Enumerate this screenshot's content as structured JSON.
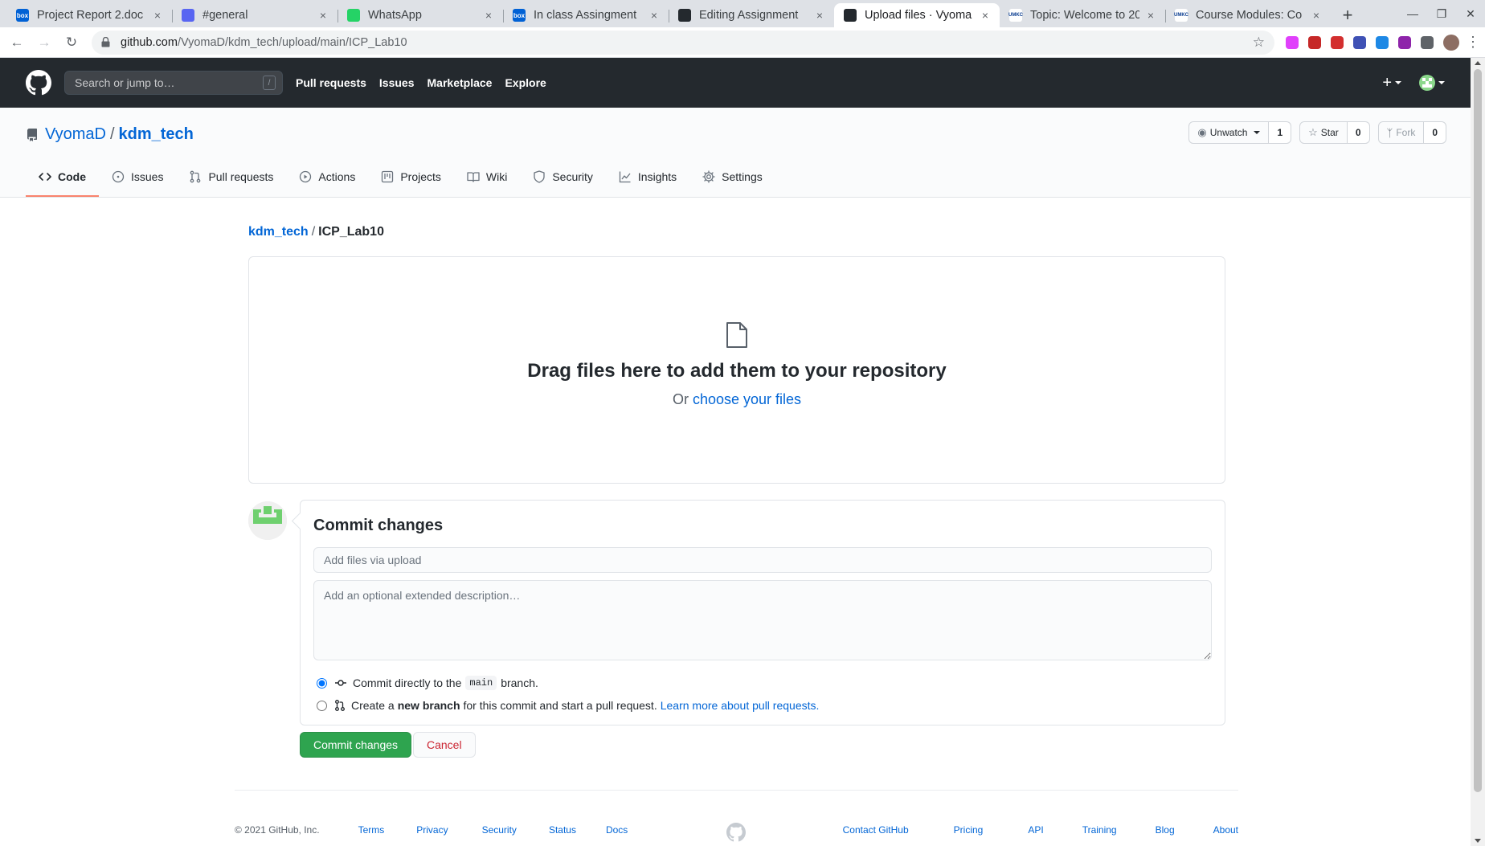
{
  "browser": {
    "tabs": [
      {
        "label": "Project Report 2.doc",
        "fav_color": "#0061d5",
        "fav_text": "box",
        "active": false
      },
      {
        "label": "#general",
        "fav_color": "#5865f2",
        "fav_text": "",
        "active": false
      },
      {
        "label": "WhatsApp",
        "fav_color": "#25d366",
        "fav_text": "",
        "active": false
      },
      {
        "label": "In class Assingment",
        "fav_color": "#0061d5",
        "fav_text": "box",
        "active": false
      },
      {
        "label": "Editing Assignment",
        "fav_color": "#24292e",
        "fav_text": "",
        "active": false
      },
      {
        "label": "Upload files · Vyoma",
        "fav_color": "#24292e",
        "fav_text": "",
        "active": true
      },
      {
        "label": "Topic: Welcome to 20",
        "fav_color": "#ffffff",
        "fav_text": "UMKC",
        "active": false
      },
      {
        "label": "Course Modules: Co",
        "fav_color": "#ffffff",
        "fav_text": "UMKC",
        "active": false
      }
    ],
    "new_tab": "+",
    "close_glyph": "×",
    "url_host": "github.com",
    "url_path": "/VyomaD/kdm_tech/upload/main/ICP_Lab10",
    "extension_colors": [
      "#e040fb",
      "#c62828",
      "#d32f2f",
      "#3f51b5",
      "#1e88e5",
      "#8e24aa",
      "#5f6368"
    ]
  },
  "gh_header": {
    "search_placeholder": "Search or jump to…",
    "search_key": "/",
    "nav": [
      "Pull requests",
      "Issues",
      "Marketplace",
      "Explore"
    ],
    "plus": "+"
  },
  "repo": {
    "owner": "VyomaD",
    "separator": "/",
    "name": "kdm_tech",
    "watch_label": "Unwatch",
    "watch_count": "1",
    "star_label": "Star",
    "star_count": "0",
    "fork_label": "Fork",
    "fork_count": "0",
    "tabs": [
      {
        "label": "Code",
        "icon": "code-icon",
        "selected": true
      },
      {
        "label": "Issues",
        "icon": "issue-icon",
        "selected": false
      },
      {
        "label": "Pull requests",
        "icon": "pull-request-icon",
        "selected": false
      },
      {
        "label": "Actions",
        "icon": "actions-icon",
        "selected": false
      },
      {
        "label": "Projects",
        "icon": "projects-icon",
        "selected": false
      },
      {
        "label": "Wiki",
        "icon": "wiki-icon",
        "selected": false
      },
      {
        "label": "Security",
        "icon": "shield-icon",
        "selected": false
      },
      {
        "label": "Insights",
        "icon": "graph-icon",
        "selected": false
      },
      {
        "label": "Settings",
        "icon": "gear-icon",
        "selected": false
      }
    ]
  },
  "upload": {
    "breadcrumb_repo": "kdm_tech",
    "breadcrumb_sep": "/",
    "breadcrumb_dir": "ICP_Lab10",
    "drag_title": "Drag files here to add them to your repository",
    "or_text": "Or",
    "choose_link": "choose your files"
  },
  "commit": {
    "title": "Commit changes",
    "summary_placeholder": "Add files via upload",
    "description_placeholder": "Add an optional extended description…",
    "option1_prefix": "Commit directly to the",
    "option1_branch": "main",
    "option1_suffix": "branch.",
    "option2_prefix": "Create a",
    "option2_bold": "new branch",
    "option2_suffix": "for this commit and start a pull request.",
    "option2_link": "Learn more about pull requests.",
    "submit_label": "Commit changes",
    "cancel_label": "Cancel"
  },
  "footer": {
    "copyright": "© 2021 GitHub, Inc.",
    "left_links": [
      "Terms",
      "Privacy",
      "Security",
      "Status",
      "Docs"
    ],
    "right_links": [
      "Contact GitHub",
      "Pricing",
      "API",
      "Training",
      "Blog",
      "About"
    ]
  },
  "colors": {
    "header_bg": "#24292e",
    "link": "#0366d6",
    "primary_button": "#2ea44f",
    "cancel_text": "#cb2431",
    "selected_tab_underline": "#f9826c"
  }
}
